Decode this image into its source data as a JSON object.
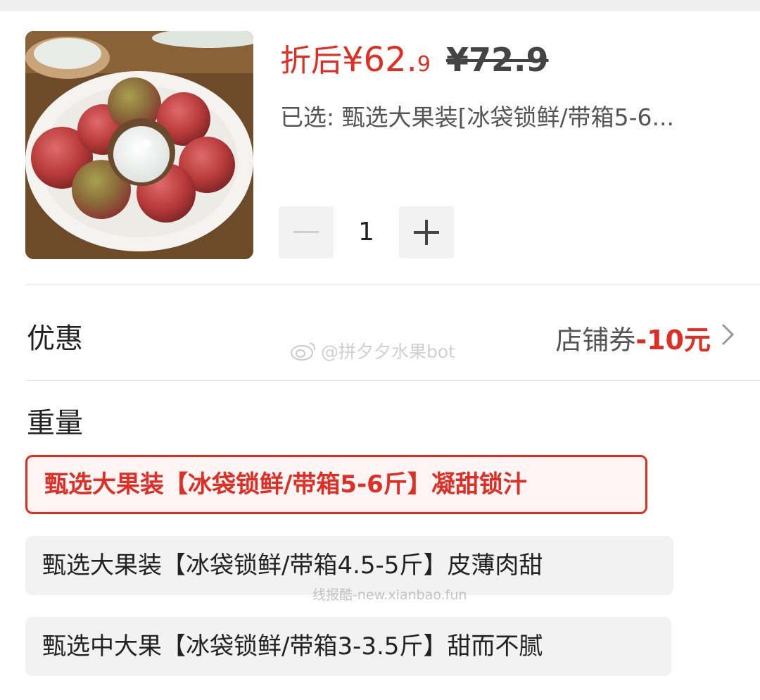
{
  "product": {
    "price_label": "折后",
    "price_integer": "¥62.",
    "price_decimal": "9",
    "original_price": "¥72.9",
    "selected": "已选: 甄选大果装[冰袋锁鲜/带箱5-6..."
  },
  "stepper": {
    "minus": "−",
    "quantity": "1",
    "plus": "+"
  },
  "promotion": {
    "label": "优惠",
    "coupon_prefix": "店铺券",
    "coupon_amount": "-10元"
  },
  "weight": {
    "label": "重量",
    "options": [
      {
        "label": "甄选大果装【冰袋锁鲜/带箱5-6斤】凝甜锁汁",
        "selected": true
      },
      {
        "label": "甄选大果装【冰袋锁鲜/带箱4.5-5斤】皮薄肉甜",
        "selected": false
      },
      {
        "label": "甄选中大果【冰袋锁鲜/带箱3-3.5斤】甜而不腻",
        "selected": false
      }
    ]
  },
  "watermarks": {
    "top": "@拼夕夕水果bot",
    "bottom": "线报酷-new.xianbao.fun"
  },
  "colors": {
    "accent": "#e02e24",
    "background": "#ffffff",
    "option_bg": "#f2f2f2"
  },
  "icons": [
    "weibo-icon",
    "chevron-right-icon",
    "minus-icon",
    "plus-icon"
  ]
}
